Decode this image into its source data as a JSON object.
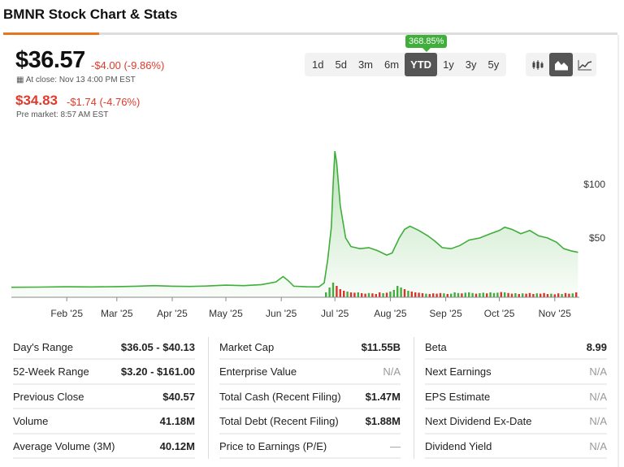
{
  "title": "BMNR Stock Chart & Stats",
  "quote": {
    "price": "$36.57",
    "change": "-$4.00 (-9.86%)",
    "close_time": "At close: Nov 13 4:00 PM EST",
    "pre_price": "$34.83",
    "pre_change": "-$1.74 (-4.76%)",
    "pre_time": "Pre market: 8:57 AM EST"
  },
  "ranges": [
    "1d",
    "5d",
    "3m",
    "6m",
    "YTD",
    "1y",
    "3y",
    "5y"
  ],
  "selected_range": "YTD",
  "range_return": "368.85%",
  "chart_types": [
    "candlestick-icon",
    "area-chart-icon",
    "line-chart-icon"
  ],
  "colors": {
    "line": "#3fae3a",
    "up": "#3fae3a",
    "down": "#d9342b",
    "accent": "#e8761f"
  },
  "chart_data": {
    "type": "area",
    "x_unit": "day of year 2025",
    "y_ticks": [
      {
        "v": 100,
        "label": "$100"
      },
      {
        "v": 50,
        "label": "$50"
      }
    ],
    "x_ticks": [
      {
        "d": 31,
        "label": "Feb '25"
      },
      {
        "d": 59,
        "label": "Mar '25"
      },
      {
        "d": 90,
        "label": "Apr '25"
      },
      {
        "d": 120,
        "label": "May '25"
      },
      {
        "d": 151,
        "label": "Jun '25"
      },
      {
        "d": 181,
        "label": "Jul '25"
      },
      {
        "d": 212,
        "label": "Aug '25"
      },
      {
        "d": 243,
        "label": "Sep '25"
      },
      {
        "d": 273,
        "label": "Oct '25"
      },
      {
        "d": 304,
        "label": "Nov '25"
      }
    ],
    "price": [
      [
        0,
        4
      ],
      [
        15,
        4.2
      ],
      [
        31,
        4.5
      ],
      [
        45,
        4.3
      ],
      [
        59,
        4.6
      ],
      [
        70,
        5
      ],
      [
        80,
        5.5
      ],
      [
        90,
        5
      ],
      [
        100,
        4.8
      ],
      [
        110,
        5.2
      ],
      [
        120,
        6
      ],
      [
        130,
        5.5
      ],
      [
        140,
        6.5
      ],
      [
        148,
        9
      ],
      [
        152,
        14
      ],
      [
        155,
        10
      ],
      [
        158,
        5
      ],
      [
        165,
        4.5
      ],
      [
        172,
        4.4
      ],
      [
        175,
        8
      ],
      [
        177,
        30
      ],
      [
        179,
        60
      ],
      [
        180,
        100
      ],
      [
        181,
        131
      ],
      [
        182,
        120
      ],
      [
        184,
        80
      ],
      [
        187,
        50
      ],
      [
        190,
        42
      ],
      [
        195,
        40
      ],
      [
        200,
        41
      ],
      [
        205,
        38
      ],
      [
        210,
        34
      ],
      [
        213,
        36
      ],
      [
        217,
        50
      ],
      [
        220,
        58
      ],
      [
        223,
        61
      ],
      [
        228,
        57
      ],
      [
        233,
        52
      ],
      [
        237,
        47
      ],
      [
        241,
        41
      ],
      [
        246,
        40
      ],
      [
        251,
        43
      ],
      [
        256,
        48
      ],
      [
        262,
        50
      ],
      [
        268,
        54
      ],
      [
        273,
        57
      ],
      [
        276,
        60
      ],
      [
        280,
        58
      ],
      [
        285,
        54
      ],
      [
        290,
        57
      ],
      [
        295,
        52
      ],
      [
        300,
        50
      ],
      [
        305,
        46
      ],
      [
        309,
        40
      ],
      [
        313,
        38
      ],
      [
        317,
        36.6
      ]
    ],
    "volume": [
      [
        176,
        30,
        1
      ],
      [
        178,
        60,
        1
      ],
      [
        180,
        90,
        1
      ],
      [
        182,
        70,
        0
      ],
      [
        184,
        50,
        0
      ],
      [
        186,
        40,
        0
      ],
      [
        188,
        35,
        1
      ],
      [
        190,
        30,
        0
      ],
      [
        192,
        28,
        0
      ],
      [
        194,
        30,
        1
      ],
      [
        196,
        25,
        0
      ],
      [
        198,
        22,
        0
      ],
      [
        200,
        26,
        1
      ],
      [
        202,
        24,
        0
      ],
      [
        204,
        20,
        0
      ],
      [
        206,
        30,
        0
      ],
      [
        208,
        25,
        1
      ],
      [
        210,
        28,
        0
      ],
      [
        212,
        35,
        1
      ],
      [
        214,
        45,
        1
      ],
      [
        216,
        70,
        1
      ],
      [
        218,
        60,
        1
      ],
      [
        220,
        50,
        0
      ],
      [
        222,
        40,
        1
      ],
      [
        224,
        35,
        0
      ],
      [
        226,
        30,
        0
      ],
      [
        228,
        28,
        0
      ],
      [
        230,
        25,
        0
      ],
      [
        232,
        22,
        1
      ],
      [
        234,
        20,
        0
      ],
      [
        236,
        24,
        0
      ],
      [
        238,
        22,
        0
      ],
      [
        240,
        26,
        0
      ],
      [
        242,
        24,
        1
      ],
      [
        244,
        20,
        0
      ],
      [
        246,
        22,
        1
      ],
      [
        248,
        30,
        1
      ],
      [
        250,
        26,
        1
      ],
      [
        252,
        24,
        0
      ],
      [
        254,
        28,
        1
      ],
      [
        256,
        30,
        1
      ],
      [
        258,
        26,
        1
      ],
      [
        260,
        22,
        0
      ],
      [
        262,
        25,
        1
      ],
      [
        264,
        28,
        1
      ],
      [
        266,
        24,
        0
      ],
      [
        268,
        30,
        1
      ],
      [
        270,
        26,
        1
      ],
      [
        272,
        28,
        1
      ],
      [
        274,
        32,
        0
      ],
      [
        276,
        30,
        1
      ],
      [
        278,
        26,
        0
      ],
      [
        280,
        22,
        0
      ],
      [
        282,
        25,
        1
      ],
      [
        284,
        20,
        0
      ],
      [
        286,
        24,
        1
      ],
      [
        288,
        22,
        0
      ],
      [
        290,
        26,
        0
      ],
      [
        292,
        20,
        0
      ],
      [
        294,
        24,
        1
      ],
      [
        296,
        22,
        0
      ],
      [
        298,
        26,
        0
      ],
      [
        300,
        20,
        0
      ],
      [
        302,
        22,
        1
      ],
      [
        304,
        18,
        0
      ],
      [
        306,
        24,
        0
      ],
      [
        308,
        20,
        1
      ],
      [
        310,
        26,
        0
      ],
      [
        312,
        22,
        0
      ],
      [
        314,
        24,
        1
      ],
      [
        316,
        30,
        0
      ]
    ]
  },
  "stats": [
    [
      {
        "label": "Day's Range",
        "value": "$36.05 - $40.13"
      },
      {
        "label": "52-Week Range",
        "value": "$3.20 - $161.00"
      },
      {
        "label": "Previous Close",
        "value": "$40.57"
      },
      {
        "label": "Volume",
        "value": "41.18M"
      },
      {
        "label": "Average Volume (3M)",
        "value": "40.12M"
      }
    ],
    [
      {
        "label": "Market Cap",
        "value": "$11.55B"
      },
      {
        "label": "Enterprise Value",
        "value": "N/A"
      },
      {
        "label": "Total Cash (Recent Filing)",
        "value": "$1.47M"
      },
      {
        "label": "Total Debt (Recent Filing)",
        "value": "$1.88M"
      },
      {
        "label": "Price to Earnings (P/E)",
        "value": "—"
      }
    ],
    [
      {
        "label": "Beta",
        "value": "8.99"
      },
      {
        "label": "Next Earnings",
        "value": "N/A"
      },
      {
        "label": "EPS Estimate",
        "value": "N/A"
      },
      {
        "label": "Next Dividend Ex-Date",
        "value": "N/A"
      },
      {
        "label": "Dividend Yield",
        "value": "N/A"
      }
    ]
  ]
}
